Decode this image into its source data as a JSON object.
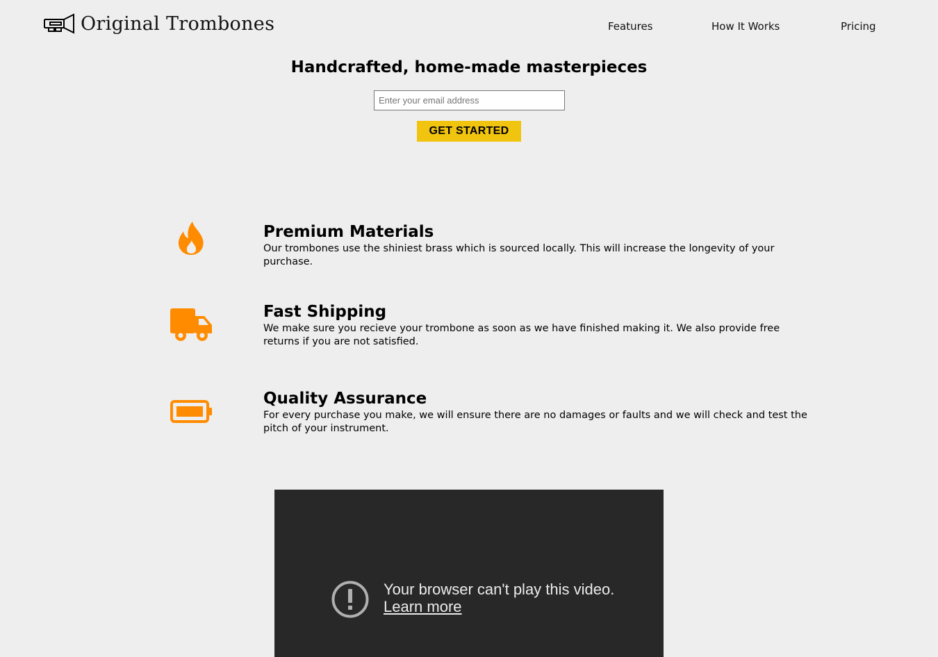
{
  "header": {
    "brand_name": "Original Trombones",
    "logo_icon": "trombone-icon",
    "nav": [
      {
        "label": "Features"
      },
      {
        "label": "How It Works"
      },
      {
        "label": "Pricing"
      }
    ]
  },
  "hero": {
    "title": "Handcrafted, home-made masterpieces",
    "email_placeholder": "Enter your email address",
    "email_value": "",
    "cta_label": "GET STARTED",
    "cta_color": "#f1c40f"
  },
  "features": [
    {
      "icon": "fire-icon",
      "title": "Premium Materials",
      "description": "Our trombones use the shiniest brass which is sourced locally. This will increase the longevity of your purchase."
    },
    {
      "icon": "truck-icon",
      "title": "Fast Shipping",
      "description": "We make sure you recieve your trombone as soon as we have finished making it. We also provide free returns if you are not satisfied."
    },
    {
      "icon": "battery-icon",
      "title": "Quality Assurance",
      "description": "For every purchase you make, we will ensure there are no damages or faults and we will check and test the pitch of your instrument."
    }
  ],
  "feature_icon_color": "#ff8c00",
  "video": {
    "error_message": "Your browser can't play this video.",
    "learn_more": "Learn more",
    "icon": "alert-icon"
  }
}
